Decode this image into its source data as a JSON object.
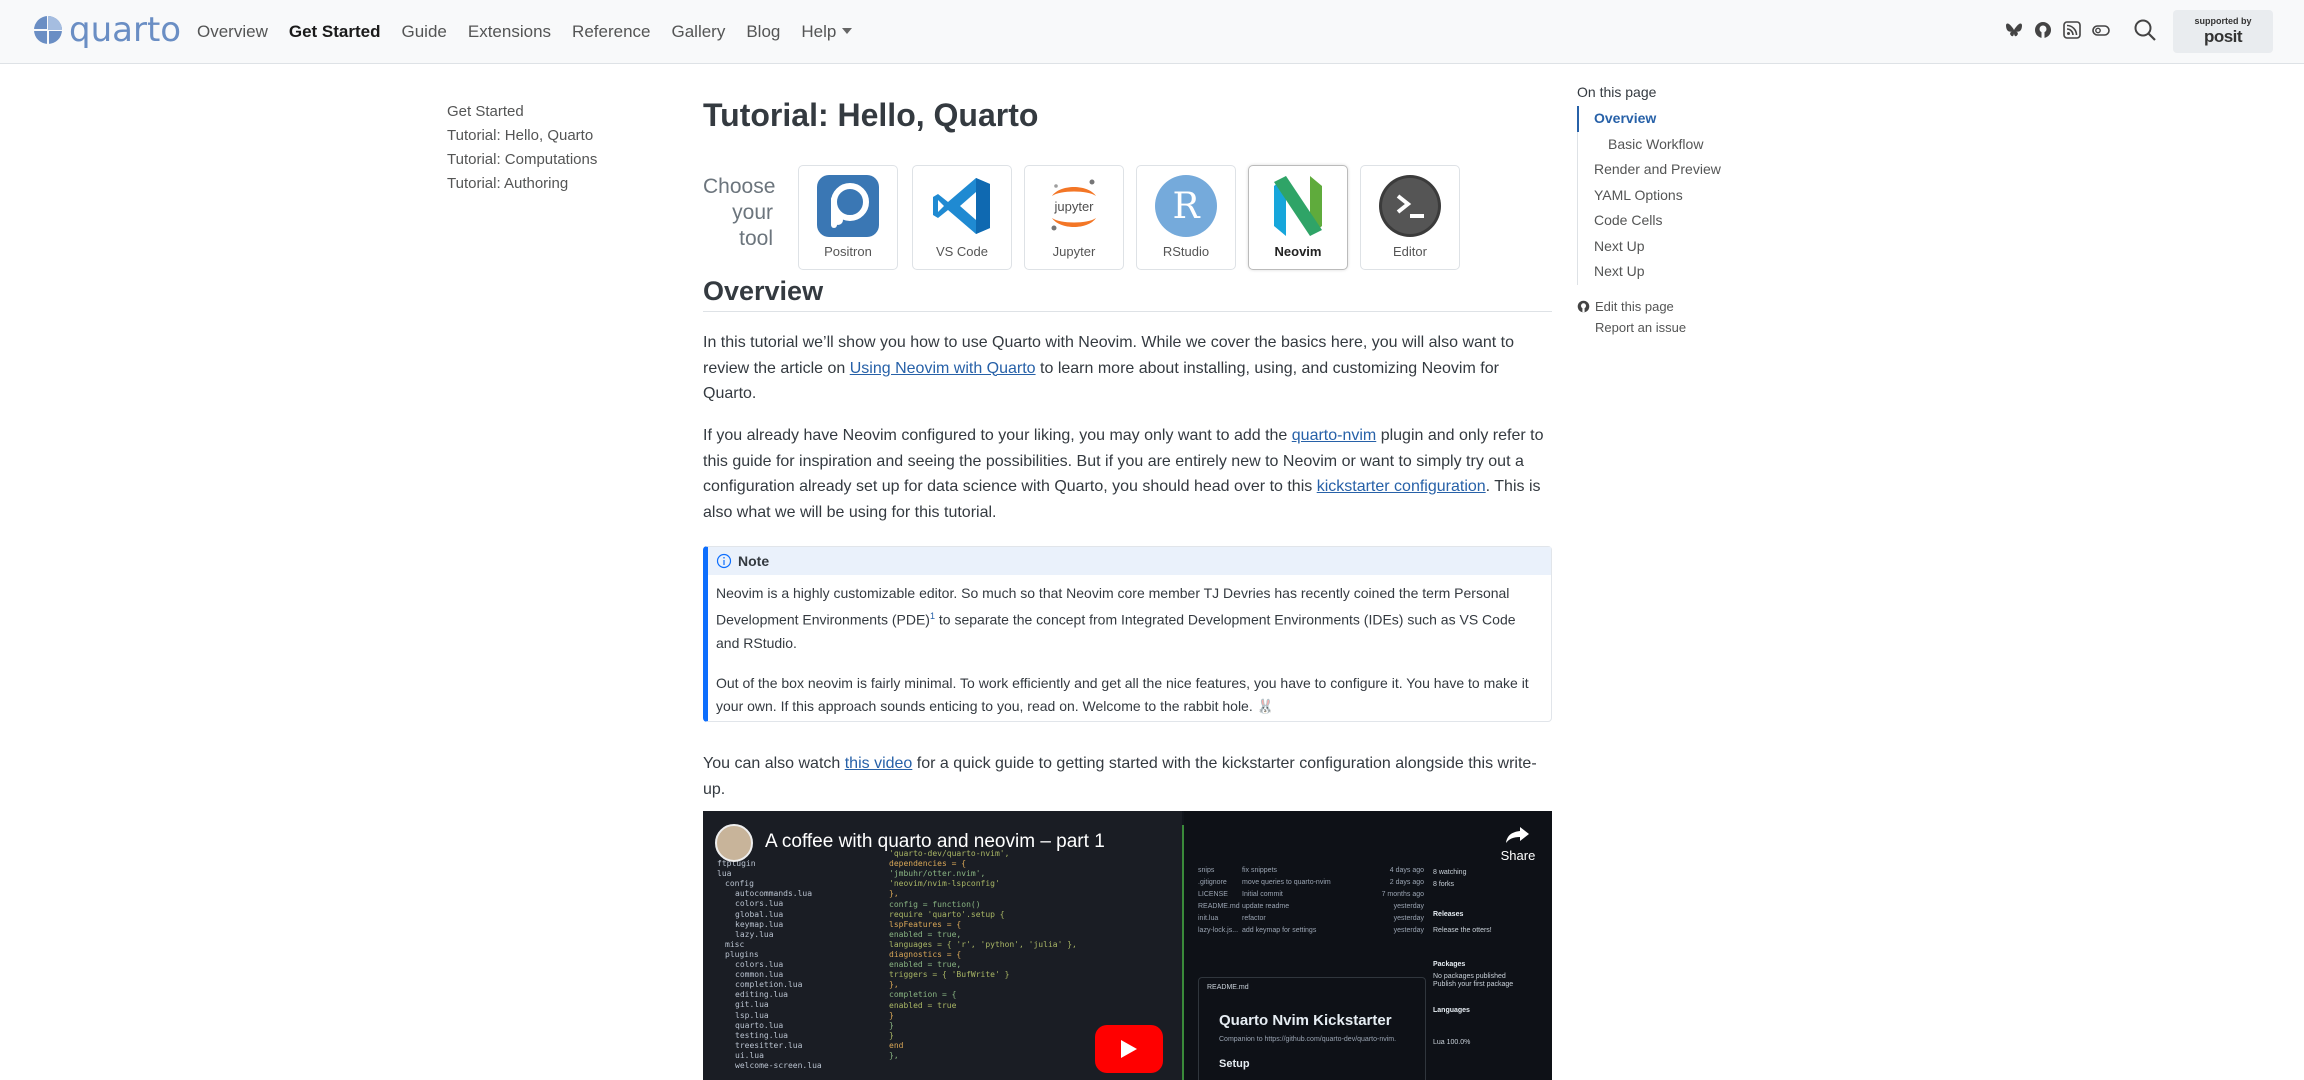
{
  "brand": {
    "name": "quarto",
    "accent": "#6a8ec4"
  },
  "nav": {
    "links": [
      "Overview",
      "Get Started",
      "Guide",
      "Extensions",
      "Reference",
      "Gallery",
      "Blog",
      "Help"
    ],
    "active": "Get Started",
    "icons": [
      "bluesky-icon",
      "github-icon",
      "rss-icon",
      "reader-mode-icon",
      "search-icon"
    ],
    "posit": {
      "supported_by": "supported by",
      "name": "posit"
    }
  },
  "sidebar": {
    "items": [
      "Get Started",
      "Tutorial: Hello, Quarto",
      "Tutorial: Computations",
      "Tutorial: Authoring"
    ]
  },
  "main": {
    "title": "Tutorial: Hello, Quarto",
    "chooser": {
      "label_lines": [
        "Choose",
        "your",
        "tool"
      ],
      "tools": [
        {
          "name": "Positron",
          "selected": false
        },
        {
          "name": "VS Code",
          "selected": false
        },
        {
          "name": "Jupyter",
          "selected": false
        },
        {
          "name": "RStudio",
          "selected": false
        },
        {
          "name": "Neovim",
          "selected": true
        },
        {
          "name": "Editor",
          "selected": false
        }
      ]
    },
    "overview_heading": "Overview",
    "p1": {
      "before": "In this tutorial we’ll show you how to use Quarto with Neovim. While we cover the basics here, you will also want to review the article on ",
      "link": "Using Neovim with Quarto",
      "after": " to learn more about installing, using, and customizing Neovim for Quarto."
    },
    "p2": {
      "a": "If you already have Neovim configured to your liking, you may only want to add the ",
      "link1": "quarto-nvim",
      "b": " plugin and only refer to this guide for inspiration and seeing the possibilities. But if you are entirely new to Neovim or want to simply try out a configuration already set up for data science with Quarto, you should head over to this ",
      "link2": "kickstarter configuration",
      "c": ". This is also what we will be using for this tutorial."
    },
    "note": {
      "title": "Note",
      "p1_before": "Neovim is a highly customizable editor. So much so that Neovim core member TJ Devries has recently coined the term Personal Development Environments (PDE)",
      "footnote": "1",
      "p1_after": " to separate the concept from Integrated Development Environments (IDEs) such as VS Code and RStudio.",
      "p2": "Out of the box neovim is fairly minimal. To work efficiently and get all the nice features, you have to configure it. You have to make it your own. If this approach sounds enticing to you, read on. Welcome to the rabbit hole. 🐰"
    },
    "p3": {
      "before": "You can also watch ",
      "link": "this video",
      "after": " for a quick guide to getting started with the kickstarter configuration alongside this write-up."
    },
    "video": {
      "title": "A coffee with quarto and neovim – part 1",
      "share": "Share",
      "tree": [
        "ftplugin",
        "lua",
        "config",
        "autocommands.lua",
        "colors.lua",
        "global.lua",
        "keymap.lua",
        "lazy.lua",
        "misc",
        "plugins",
        "colors.lua",
        "common.lua",
        "completion.lua",
        "editing.lua",
        "git.lua",
        "lsp.lua",
        "quarto.lua",
        "testing.lua",
        "treesitter.lua",
        "ui.lua",
        "welcome-screen.lua"
      ],
      "code": [
        "'quarto-dev/quarto-nvim',",
        "dependencies = {",
        "  'jmbuhr/otter.nvim',",
        "  'neovim/nvim-lspconfig'",
        "},",
        "config = function()",
        "  require 'quarto'.setup {",
        "    lspFeatures = {",
        "      enabled = true,",
        "      languages = { 'r', 'python', 'julia' },",
        "      diagnostics = {",
        "        enabled = true,",
        "        triggers = { 'BufWrite' }",
        "      },",
        "      completion = {",
        "        enabled = true",
        "      }",
        "    }",
        "  }",
        "end",
        "},"
      ],
      "repo_rows": [
        [
          "snips",
          "fix snippets",
          "4 days ago"
        ],
        [
          ".gitignore",
          "move queries to quarto-nvim",
          "2 days ago"
        ],
        [
          "LICENSE",
          "Initial commit",
          "7 months ago"
        ],
        [
          "README.md",
          "update readme",
          "yesterday"
        ],
        [
          "init.lua",
          "refactor",
          "yesterday"
        ],
        [
          "lazy-lock.js...",
          "add keymap for settings",
          "yesterday"
        ]
      ],
      "readme_label": "README.md",
      "readme_title": "Quarto Nvim Kickstarter",
      "readme_sub": "Companion to https://github.com/quarto-dev/quarto-nvim.",
      "readme_setup": "Setup",
      "side": [
        "8 watching",
        "8 forks",
        "Releases",
        "Release the otters!",
        "Packages",
        "No packages published",
        "Publish your first package",
        "Languages",
        "Lua 100.0%"
      ]
    }
  },
  "toc": {
    "title": "On this page",
    "items": [
      "Overview",
      "Basic Workflow",
      "Render and Preview",
      "YAML Options",
      "Code Cells",
      "Next Up",
      "Next Up"
    ],
    "active": "Overview",
    "sub": [
      "Basic Workflow"
    ],
    "links": [
      "Edit this page",
      "Report an issue"
    ]
  }
}
